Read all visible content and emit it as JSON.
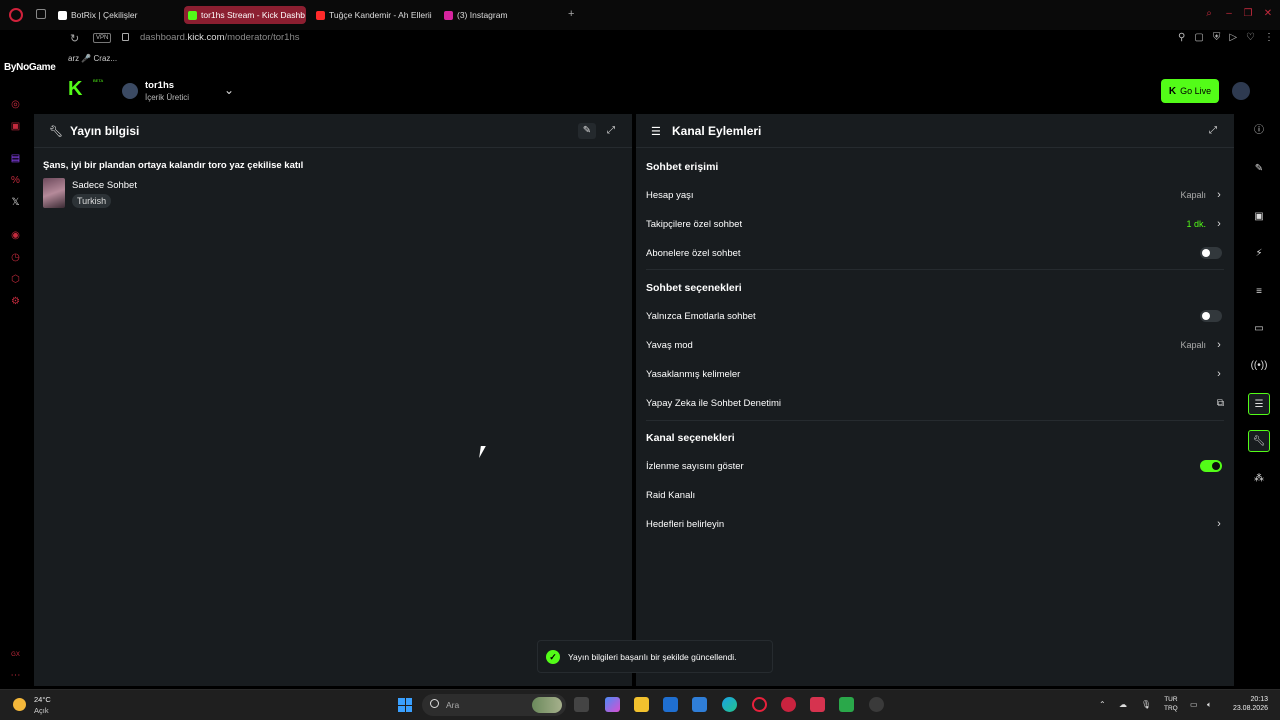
{
  "browser": {
    "tabs": [
      {
        "label": "BotRix | Çekilişler",
        "color": "#ffffff"
      },
      {
        "label": "tor1hs Stream - Kick Dashb",
        "color": "#53fc18"
      },
      {
        "label": "Tuğçe Kandemir - Ah Ellerii",
        "color": "#ff2a2a"
      },
      {
        "label": "(3) Instagram",
        "color": "#d6249f"
      }
    ],
    "url_prefix": "dashboard.",
    "url_domain": "kick.com",
    "url_path": "/moderator/tor1hs",
    "vpn_label": "VPN",
    "bookmark_text": "arz  🎤 Craz...",
    "brand_overlay": "ByNoGame"
  },
  "header": {
    "logo": "K",
    "beta": "BETA",
    "channel_name": "tor1hs",
    "channel_role": "İçerik Üretici",
    "go_live": "Go Live"
  },
  "left_panel": {
    "title": "Yayın bilgisi",
    "stream_title": "Şans, iyi bir plandan ortaya kalandır toro yaz çekilise katıl",
    "category": "Sadece Sohbet",
    "tag": "Turkish"
  },
  "right_panel": {
    "title": "Kanal Eylemleri",
    "sections": {
      "chat_access": {
        "title": "Sohbet erişimi",
        "account_age": {
          "label": "Hesap yaşı",
          "value": "Kapalı"
        },
        "followers_only": {
          "label": "Takipçilere özel sohbet",
          "value": "1 dk."
        },
        "subscribers_only": {
          "label": "Abonelere özel sohbet",
          "on": false
        }
      },
      "chat_options": {
        "title": "Sohbet seçenekleri",
        "emotes_only": {
          "label": "Yalnızca Emotlarla sohbet",
          "on": false
        },
        "slow_mode": {
          "label": "Yavaş mod",
          "value": "Kapalı"
        },
        "banned_words": {
          "label": "Yasaklanmış kelimeler"
        },
        "ai_moderation": {
          "label": "Yapay Zeka ile Sohbet Denetimi"
        }
      },
      "channel_options": {
        "title": "Kanal seçenekleri",
        "show_viewers": {
          "label": "İzlenme sayısını göster",
          "on": true
        },
        "raid": {
          "label": "Raid Kanalı"
        },
        "goals": {
          "label": "Hedefleri belirleyin"
        }
      }
    }
  },
  "toast": {
    "message": "Yayın bilgileri başarılı bir şekilde güncellendi."
  },
  "taskbar": {
    "temp": "24°C",
    "weather": "Açık",
    "search_placeholder": "Ara",
    "lang_1": "TUR",
    "lang_2": "TRQ",
    "time": "20:13",
    "date": "23.08.2026"
  },
  "colors": {
    "accent": "#53fc18",
    "panel_bg": "#181c1f",
    "opera_red": "#c42a3d"
  }
}
